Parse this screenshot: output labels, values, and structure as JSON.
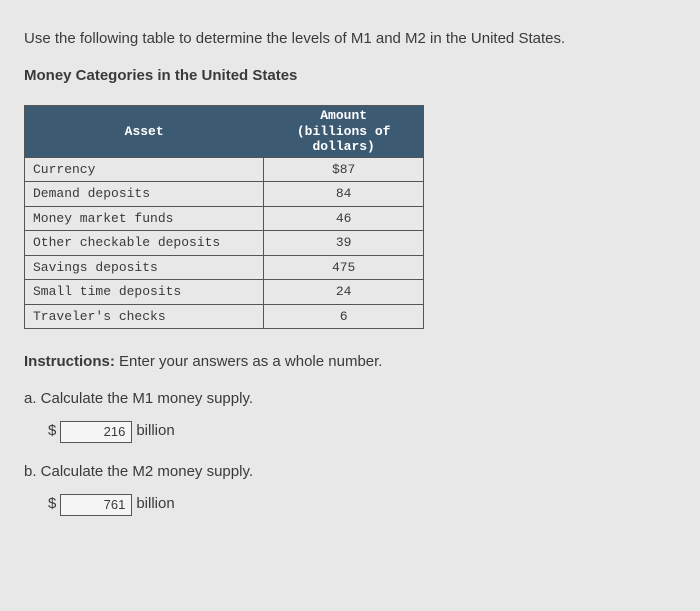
{
  "intro": "Use the following table to determine the levels of M1 and M2 in the United States.",
  "subtitle": "Money Categories in the United States",
  "table": {
    "headers": {
      "asset": "Asset",
      "amount": "Amount (billions of dollars)"
    },
    "amount_line1": "Amount",
    "amount_line2": "(billions of",
    "amount_line3": "dollars)",
    "rows": [
      {
        "asset": "Currency",
        "amount": "$87"
      },
      {
        "asset": "Demand deposits",
        "amount": "84"
      },
      {
        "asset": "Money market funds",
        "amount": "46"
      },
      {
        "asset": "Other checkable deposits",
        "amount": "39"
      },
      {
        "asset": "Savings deposits",
        "amount": "475"
      },
      {
        "asset": "Small time deposits",
        "amount": "24"
      },
      {
        "asset": "Traveler's checks",
        "amount": "6"
      }
    ]
  },
  "instructions_label": "Instructions:",
  "instructions_text": " Enter your answers as a whole number.",
  "qa": {
    "a_prompt": "a. Calculate the M1 money supply.",
    "a_value": "216",
    "b_prompt": "b. Calculate the M2 money supply.",
    "b_value": "761",
    "currency_symbol": "$",
    "unit": "billion"
  }
}
